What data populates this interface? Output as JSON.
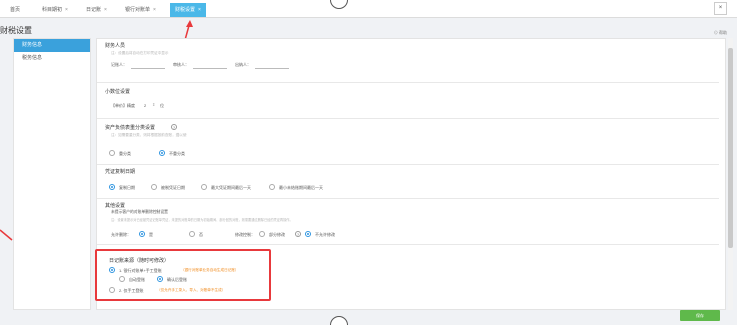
{
  "tabs": [
    {
      "label": "首页",
      "closable": false
    },
    {
      "label": "科目期初",
      "closable": true
    },
    {
      "label": "日记账",
      "closable": true
    },
    {
      "label": "银行对账单",
      "closable": true
    },
    {
      "label": "财税设置",
      "closable": true,
      "active": true
    }
  ],
  "close_glyph": "×",
  "page_title": "财税设置",
  "help_label": "⊙ 帮助",
  "sidebar": [
    "财务信息",
    "税务信息"
  ],
  "finance_staff": {
    "title": "财务人员",
    "hint": "注：设置后将自动在打印凭证中显示",
    "fields": [
      "记账人：",
      "审核人：",
      "出纳人："
    ]
  },
  "decimal": {
    "title": "小数位设置",
    "label": "【单价】精度",
    "value": "2",
    "unit": "位"
  },
  "balance_sheet": {
    "title": "资产负债表重分类设置",
    "hint": "注：如需要重分类，则将根据按前查账，遵以使",
    "options": [
      "重分类",
      "不重分类"
    ],
    "selected": 1
  },
  "voucher_date": {
    "title": "凭证复制日期",
    "options": [
      "复制日期",
      "被制凭证日期",
      "最大凭证期间最后一天",
      "最小未结账期间最后一天"
    ],
    "selected": 0
  },
  "other": {
    "title": "其他设置",
    "line1": "未提示客户的对账单删除控制设置",
    "line2": "注：设置未提示对已经被凭证记账单凭证，未提的对账单的日期为初始期间、部分回的对账，则需要通过删除已经的凭证再操作。",
    "allow_delete_label": "允许删除：",
    "yes": "是",
    "no": "否",
    "edit_control_label": "修改控制：",
    "partial_edit": "部分修改",
    "no_edit": "不允许修改"
  },
  "journal": {
    "title": "日记账来源（随时可修改）",
    "option1": "1. 银行对账单+手工登账",
    "option1_note": "（银行对账单业务自动生成日记账）",
    "sub_auto": "自动登账",
    "sub_confirm": "确认后登账",
    "option2": "2. 仅手工登账",
    "option2_note": "（仅允许手工录入、导入、对账单不生成）"
  },
  "save_label": "保存",
  "colors": {
    "accent": "#4bb8e8",
    "sidebar_active": "#3aa1dc",
    "save_green": "#5fb94b",
    "highlight_red": "#e8393c",
    "note_orange": "#f08a1c"
  }
}
